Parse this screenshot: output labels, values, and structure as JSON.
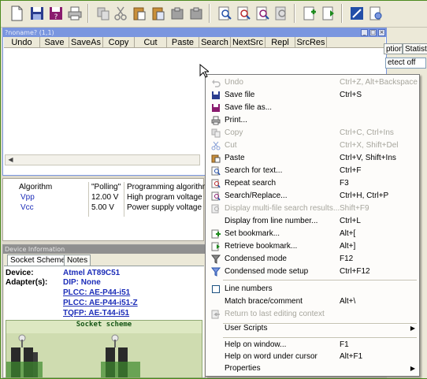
{
  "editor": {
    "title": "?noname? (1,1)",
    "toolbar": [
      {
        "label": "Undo",
        "enabled": false
      },
      {
        "label": "Save",
        "enabled": true
      },
      {
        "label": "SaveAs",
        "enabled": true
      },
      {
        "label": "Copy",
        "enabled": false
      },
      {
        "label": "Cut",
        "enabled": false
      },
      {
        "label": "Paste",
        "enabled": true
      },
      {
        "label": "Search",
        "enabled": true
      },
      {
        "label": "NextSrc",
        "enabled": true
      },
      {
        "label": "Repl",
        "enabled": true
      },
      {
        "label": "SrcRes",
        "enabled": false
      }
    ]
  },
  "properties": [
    {
      "name": "Algorithm",
      "value": "\"Polling\"",
      "desc": "Programming algorithm"
    },
    {
      "name": "Vpp",
      "value": "12.00 V",
      "desc": "High program voltage"
    },
    {
      "name": "Vcc",
      "value": "5.00 V",
      "desc": "Power supply voltage"
    }
  ],
  "device_info": {
    "title": "Device Information",
    "tabs": [
      "Socket Scheme",
      "Notes"
    ],
    "device_label": "Device:",
    "device_value": "Atmel AT89C51",
    "adapters_label": "Adapter(s):",
    "adapters": [
      "DIP: None",
      "PLCC: AE-P44-i51",
      "PLCC: AE-P44-i51-Z",
      "TQFP: AE-T44-i51"
    ],
    "socket_title": "Socket scheme"
  },
  "right_panel": {
    "tabs": [
      "ptions",
      "Statisti"
    ],
    "field": "etect off"
  },
  "context_menu": {
    "groups": [
      [
        {
          "label": "Undo",
          "shortcut": "Ctrl+Z, Alt+Backspace",
          "enabled": false,
          "icon": "undo-icon"
        },
        {
          "label": "Save file",
          "shortcut": "Ctrl+S",
          "enabled": true,
          "icon": "save-icon"
        },
        {
          "label": "Save file as...",
          "shortcut": "",
          "enabled": true,
          "icon": "save-as-icon"
        },
        {
          "label": "Print...",
          "shortcut": "",
          "enabled": true,
          "icon": "print-icon"
        },
        {
          "label": "Copy",
          "shortcut": "Ctrl+C, Ctrl+Ins",
          "enabled": false,
          "icon": "copy-icon"
        },
        {
          "label": "Cut",
          "shortcut": "Ctrl+X, Shift+Del",
          "enabled": false,
          "icon": "cut-icon"
        },
        {
          "label": "Paste",
          "shortcut": "Ctrl+V, Shift+Ins",
          "enabled": true,
          "icon": "paste-icon"
        },
        {
          "label": "Search for text...",
          "shortcut": "Ctrl+F",
          "enabled": true,
          "icon": "search-icon"
        },
        {
          "label": "Repeat search",
          "shortcut": "F3",
          "enabled": true,
          "icon": "repeat-search-icon"
        },
        {
          "label": "Search/Replace...",
          "shortcut": "Ctrl+H, Ctrl+P",
          "enabled": true,
          "icon": "replace-icon"
        },
        {
          "label": "Display multi-file search results...",
          "shortcut": "Shift+F9",
          "enabled": false,
          "icon": "search-results-icon"
        },
        {
          "label": "Display from line number...",
          "shortcut": "Ctrl+L",
          "enabled": true,
          "icon": ""
        },
        {
          "label": "Set bookmark...",
          "shortcut": "Alt+[",
          "enabled": true,
          "icon": "set-bookmark-icon"
        },
        {
          "label": "Retrieve bookmark...",
          "shortcut": "Alt+]",
          "enabled": true,
          "icon": "retrieve-bookmark-icon"
        },
        {
          "label": "Condensed mode",
          "shortcut": "F12",
          "enabled": true,
          "icon": "filter-icon"
        },
        {
          "label": "Condensed mode setup",
          "shortcut": "Ctrl+F12",
          "enabled": true,
          "icon": "filter-setup-icon"
        }
      ],
      [
        {
          "label": "Line numbers",
          "shortcut": "",
          "enabled": true,
          "icon": "checkbox"
        },
        {
          "label": "Match brace/comment",
          "shortcut": "Alt+\\",
          "enabled": true,
          "icon": ""
        },
        {
          "label": "Return to last editing context",
          "shortcut": "",
          "enabled": false,
          "icon": "return-icon"
        }
      ],
      [
        {
          "label": "User Scripts",
          "shortcut": "",
          "enabled": true,
          "icon": "",
          "submenu": true
        }
      ],
      [
        {
          "label": "Help on window...",
          "shortcut": "F1",
          "enabled": true,
          "icon": ""
        },
        {
          "label": "Help on word under cursor",
          "shortcut": "Alt+F1",
          "enabled": true,
          "icon": ""
        },
        {
          "label": "Properties",
          "shortcut": "",
          "enabled": true,
          "icon": "",
          "submenu": true
        }
      ]
    ]
  },
  "colors": {
    "window_title": "#7a96df",
    "menu_bg": "#fdfcfa",
    "disabled_text": "#a7a69d",
    "device_link": "#1c2db8"
  }
}
